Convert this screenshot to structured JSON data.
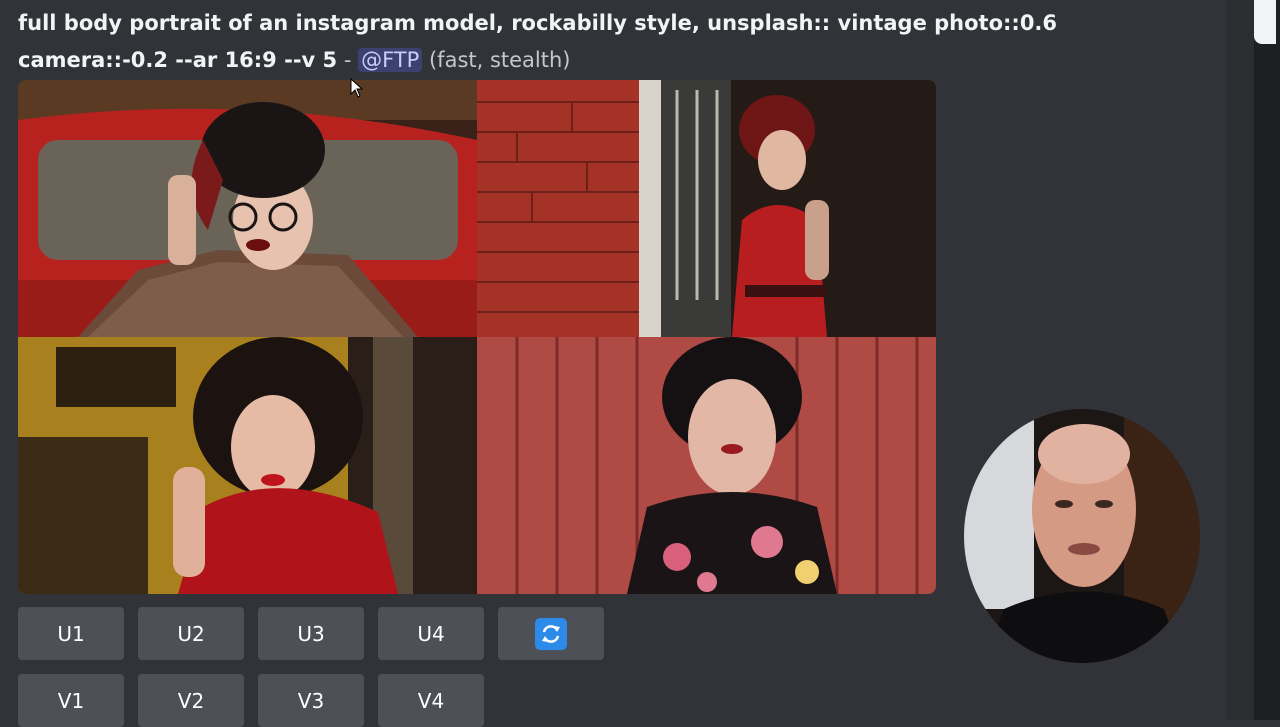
{
  "message": {
    "prompt_line1": "full body portrait of an instagram model, rockabilly style, unsplash:: vintage photo::0.6",
    "prompt_line2": "camera::-0.2 --ar 16:9 --v 5",
    "separator": " - ",
    "mention": "@FTP",
    "mode": "(fast, stealth)"
  },
  "image_grid": {
    "images": [
      "image-1",
      "image-2",
      "image-3",
      "image-4"
    ]
  },
  "buttons": {
    "upscale": [
      "U1",
      "U2",
      "U3",
      "U4"
    ],
    "variation": [
      "V1",
      "V2",
      "V3",
      "V4"
    ],
    "reroll_icon": "refresh-icon"
  },
  "colors": {
    "background": "#313338",
    "button": "#4e5058",
    "mention_bg": "#3c4270",
    "reroll_blue": "#2c8ae8"
  }
}
